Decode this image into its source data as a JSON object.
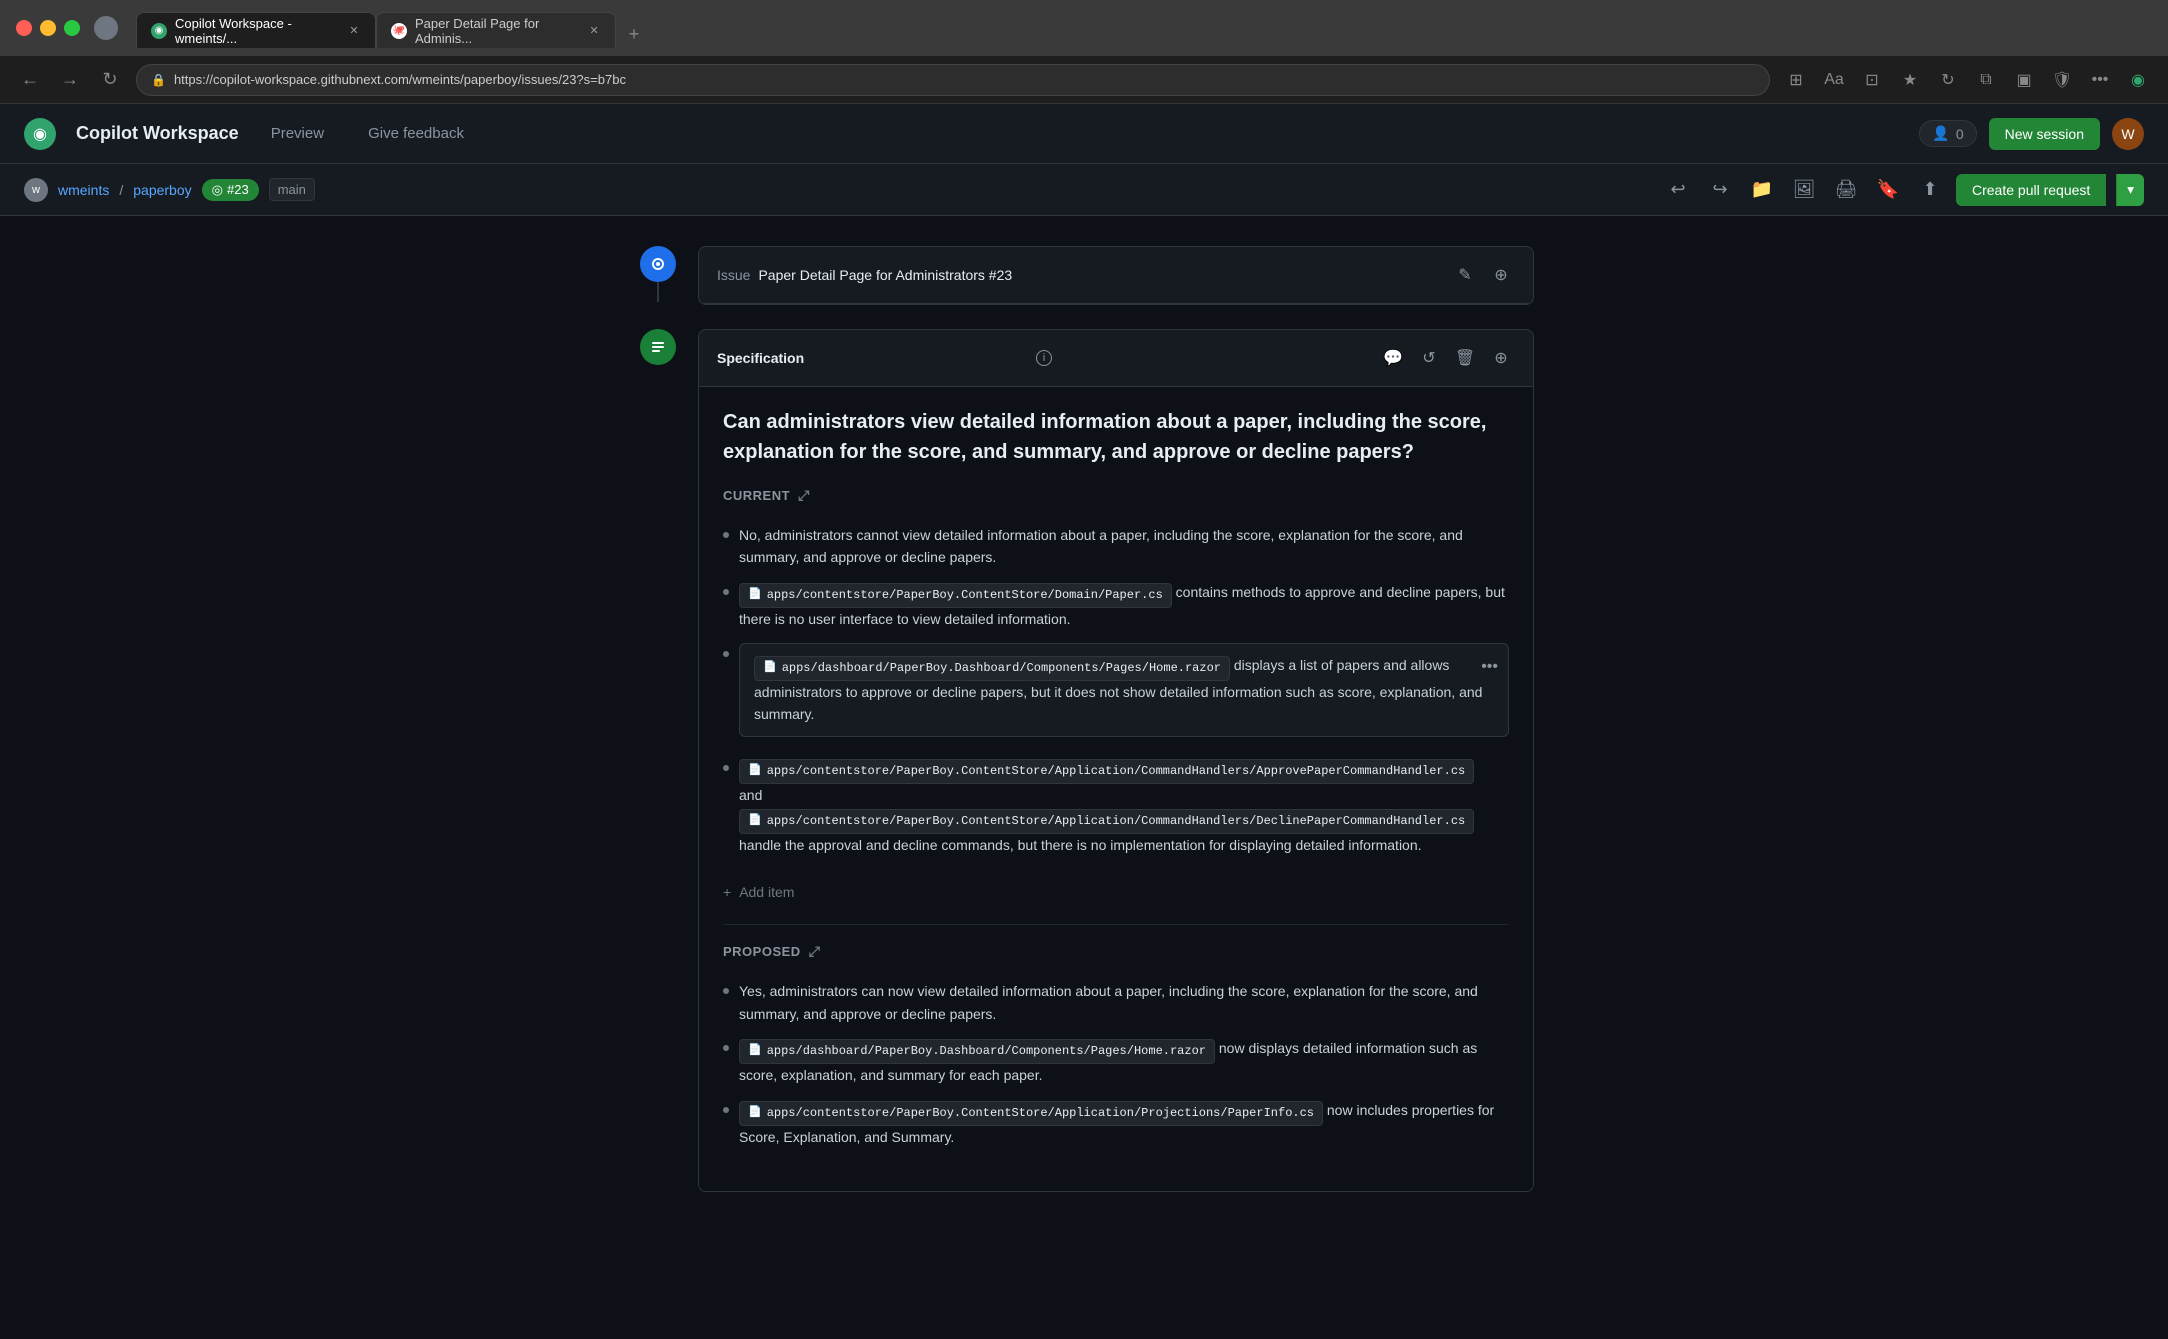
{
  "browser": {
    "tabs": [
      {
        "id": "tab-copilot",
        "label": "Copilot Workspace - wmeints/...",
        "active": true,
        "favicon": "copilot"
      },
      {
        "id": "tab-paper",
        "label": "Paper Detail Page for Adminis...",
        "active": false,
        "favicon": "github"
      }
    ],
    "address": "https://copilot-workspace.githubnext.com/wmeints/paperboy/issues/23?s=b7bc",
    "nav_back": "←",
    "nav_forward": "→",
    "nav_refresh": "↻"
  },
  "header": {
    "logo_symbol": "◉",
    "app_title": "Copilot Workspace",
    "preview_label": "Preview",
    "feedback_label": "Give feedback",
    "counter": "0",
    "new_session_label": "New session",
    "avatar_initial": "W"
  },
  "subheader": {
    "repo_owner": "wmeints",
    "repo_sep": "/",
    "repo_name": "paperboy",
    "issue_number": "#23",
    "branch": "main",
    "create_pr_label": "Create pull request",
    "create_pr_dropdown": "▾"
  },
  "breadcrumb": {
    "avatar_initial": "w"
  },
  "issue_card": {
    "label": "Issue",
    "title": "Paper Detail Page for Administrators #23",
    "edit_icon": "✎",
    "expand_icon": "⊕"
  },
  "spec_card": {
    "header_label": "Specification",
    "info_icon": "i",
    "comment_icon": "💬",
    "refresh_icon": "↺",
    "delete_icon": "🗑",
    "expand_icon": "⊕",
    "question": "Can administrators view detailed information about a paper, including the score, explanation for the score, and summary, and approve or decline papers?",
    "current_section": {
      "label": "Current",
      "move_icon": "⤢",
      "items": [
        {
          "type": "text",
          "content": "No, administrators cannot view detailed information about a paper, including the score, explanation for the score, and summary, and approve or decline papers."
        },
        {
          "type": "code",
          "code_ref": "apps/contentstore/PaperBoy.ContentStore/Domain/Paper.cs",
          "suffix": " contains methods to approve and decline papers, but there is no user interface to view detailed information."
        },
        {
          "type": "code-highlight",
          "code_ref": "apps/dashboard/PaperBoy.Dashboard/Components/Pages/Home.razor",
          "suffix": " displays a list of papers and allows administrators to approve or decline papers, but it does not show detailed information such as score, explanation, and summary.",
          "highlighted": true
        },
        {
          "type": "multi-code",
          "code_ref1": "apps/contentstore/PaperBoy.ContentStore/Application/CommandHandlers/ApprovePaperCommandHandler.cs",
          "separator": "and",
          "code_ref2": "apps/contentstore/PaperBoy.ContentStore/Application/CommandHandlers/DeclinePaperCommandHandler.cs",
          "suffix": "handle the approval and decline commands, but there is no implementation for displaying detailed information."
        }
      ],
      "add_item_label": "Add item"
    },
    "proposed_section": {
      "label": "Proposed",
      "move_icon": "⤢",
      "items": [
        {
          "type": "text",
          "content": "Yes, administrators can now view detailed information about a paper, including the score, explanation for the score, and summary, and approve or decline papers."
        },
        {
          "type": "code",
          "code_ref": "apps/dashboard/PaperBoy.Dashboard/Components/Pages/Home.razor",
          "suffix": " now displays detailed information such as score, explanation, and summary for each paper."
        },
        {
          "type": "code",
          "code_ref": "apps/contentstore/PaperBoy.ContentStore/Application/Projections/PaperInfo.cs",
          "suffix": " now includes properties for Score, Explanation, and Summary."
        }
      ]
    }
  }
}
